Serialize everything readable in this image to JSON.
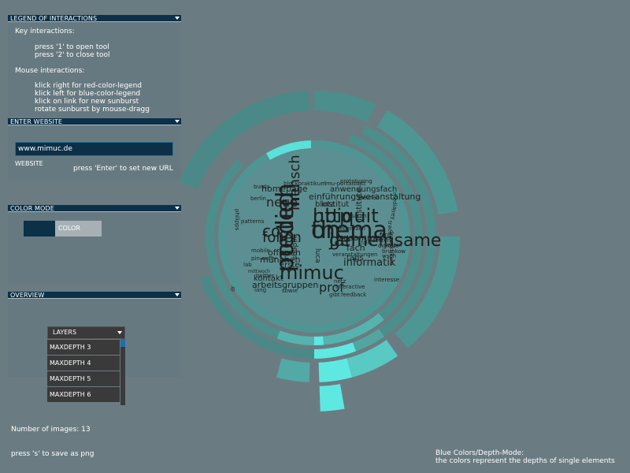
{
  "panels": {
    "legend": {
      "title": "LEGEND OF INTERACTIONS",
      "key_heading": "Key interactions:",
      "key_items": [
        "press '1' to open tool",
        "press '2' to close tool"
      ],
      "mouse_heading": "Mouse interactions:",
      "mouse_items": [
        "klick right for red-color-legend",
        "klick left for  blue-color-legend",
        "klick on link for new sunburst",
        "rotate sunburst by mouse-dragg"
      ]
    },
    "website": {
      "title": "ENTER WEBSITE",
      "url_value": "www.mimuc.de",
      "field_label": "WEBSITE",
      "hint": "press 'Enter' to set new URL"
    },
    "color_mode": {
      "title": "COLOR MODE",
      "toggle_label": "COLOR"
    },
    "overview": {
      "title": "OVERVIEW",
      "dropdown_label": "LAYERS",
      "options": [
        "MAXDEPTH 3",
        "MAXDEPTH 4",
        "MAXDEPTH 5",
        "MAXDEPTH 6"
      ]
    }
  },
  "footer": {
    "image_count": "Number of images: 13",
    "save_hint": "press 's' to save as png",
    "mode_title": "Blue Colors/Depth-Mode:",
    "mode_desc": "the colors represent the depths of single elements"
  },
  "word_cloud": {
    "words": [
      "posted",
      "on",
      "http",
      "jan",
      "lmu",
      "co",
      "mimuc",
      "folien",
      "neue",
      "prof",
      "informatik",
      "einführungsveranstaltung",
      "homepage",
      "anwendungsfach",
      "zusammen",
      "münchen",
      "offenen",
      "arbeitsgruppen",
      "kontakt",
      "erste",
      "fach",
      "tags",
      "videos",
      "luca",
      "blutz",
      "institut",
      "institute",
      "themen",
      "prototyping",
      "blockpraktikum",
      "lmu-portalstatt",
      "burda",
      "philipps",
      "berlin",
      "patterns",
      "mobile",
      "lab",
      "mittwoch",
      "twitter",
      "lang",
      "sowie",
      "interactive",
      "feedback",
      "interesse",
      "wseh",
      "brunkow",
      "digitale",
      "fand",
      "falls",
      "setzen",
      "gibt",
      "netz",
      "dr",
      "draw",
      "nebenfach",
      "sarah",
      "pin-entry",
      "veranstaltungen",
      "swipin",
      "media",
      "frey",
      "trace",
      "praktikum",
      "medien",
      "thema",
      "ubiquit",
      "gemeinsame",
      "mensch"
    ]
  },
  "colors": {
    "background": "#6a7c82",
    "panel_header": "#0b3048",
    "ring_base": "#4e9a98",
    "ring_highlight": "#5ee8e2",
    "word": "#1f1f1f"
  }
}
